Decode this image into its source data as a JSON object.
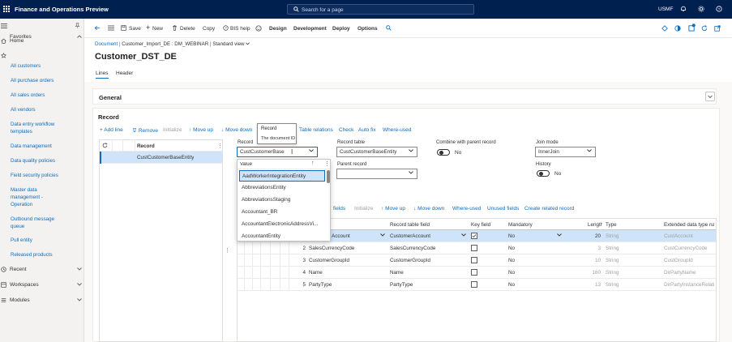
{
  "topbar": {
    "app_title": "Finance and Operations Preview",
    "search_placeholder": "Search for a page",
    "company": "USMF"
  },
  "sidebar": {
    "home": "Home",
    "favorites": "Favorites",
    "links": [
      "All customers",
      "All purchase orders",
      "All sales orders",
      "All vendors",
      "Data entry workflow templates",
      "Data management",
      "Data quality policies",
      "Field security policies",
      "Master data management - Operation",
      "Outbound message queue",
      "Pull entity",
      "Released products"
    ],
    "recent": "Recent",
    "workspaces": "Workspaces",
    "modules": "Modules"
  },
  "actionbar": {
    "save": "Save",
    "new": "New",
    "delete": "Delete",
    "copy": "Copy",
    "bis_help": "BIS help",
    "design": "Design",
    "development": "Development",
    "deploy": "Deploy",
    "options": "Options"
  },
  "breadcrumb": {
    "document": "Document",
    "sep": "|",
    "import": "Customer_Import_DE : DM_WEBINAR",
    "view": "Standard view"
  },
  "page_title": "Customer_DST_DE",
  "tabs": [
    "Lines",
    "Header"
  ],
  "general_title": "General",
  "record_section": {
    "title": "Record",
    "toolbar": {
      "add_line": "Add line",
      "remove": "Remove",
      "initialize": "Initialize",
      "move_up": "Move up",
      "move_down": "Move down",
      "record": "Record",
      "record_table": "Record table",
      "relations": "Table relations",
      "check": "Check",
      "auto_fix": "Auto fix",
      "where_used": "Where-used"
    },
    "grid_header": "Record",
    "grid_rows": [
      "CustCustomerBaseEntity"
    ],
    "tooltip": {
      "title": "Record",
      "text": "The document ID"
    }
  },
  "form": {
    "record_label": "Record",
    "record_value": "CustCustomerBase",
    "record_table_label": "Record table",
    "record_table_value": "CustCustomerBaseEntity",
    "combine_label": "Combine with parent record",
    "combine_value": "No",
    "join_mode_label": "Join mode",
    "join_mode_value": "InnerJoin",
    "parent_record_label": "Parent record",
    "parent_record_value": "",
    "history_label": "History",
    "history_value": "No"
  },
  "dropdown": {
    "header": "Value",
    "items": [
      "AadWorkerIntegrationEntity",
      "AbbreviationsEntity",
      "AbbreviationsStaging",
      "Accountant_BR",
      "AccountantElectronicAddressVi...",
      "AccountantEntity"
    ]
  },
  "fields_toolbar": {
    "fields": "fields",
    "initialize": "Initialize",
    "move_up": "Move up",
    "move_down": "Move down",
    "where_used": "Where-used",
    "unused_fields": "Unused fields",
    "create_related": "Create related record"
  },
  "fields_grid": {
    "headers": {
      "record_table_field": "Record table field",
      "key_field": "Key field",
      "mandatory": "Mandatory",
      "length": "Length",
      "type": "Type",
      "edt": "Extended data type na"
    },
    "rows": [
      {
        "num": "",
        "field": "Account",
        "table_field": "CustomerAccount",
        "key": true,
        "mandatory": "No",
        "length": "20",
        "type": "String",
        "edt": "CustAccount"
      },
      {
        "num": "2",
        "field": "SalesCurrencyCode",
        "table_field": "SalesCurrencyCode",
        "key": false,
        "mandatory": "No",
        "length": "3",
        "type": "String",
        "edt": "CustCurrencyCode"
      },
      {
        "num": "3",
        "field": "CustomerGroupId",
        "table_field": "CustomerGroupId",
        "key": false,
        "mandatory": "No",
        "length": "10",
        "type": "String",
        "edt": "CustGroupId"
      },
      {
        "num": "4",
        "field": "Name",
        "table_field": "Name",
        "key": false,
        "mandatory": "No",
        "length": "160",
        "type": "String",
        "edt": "DirPartyName"
      },
      {
        "num": "5",
        "field": "PartyType",
        "table_field": "PartyType",
        "key": false,
        "mandatory": "No",
        "length": "13",
        "type": "String",
        "edt": "DirPartyInstanceRelatio"
      }
    ]
  },
  "colors": {
    "navbar": "#002050",
    "accent": "#0f6cbd",
    "selected_row": "#cfe4fa"
  }
}
